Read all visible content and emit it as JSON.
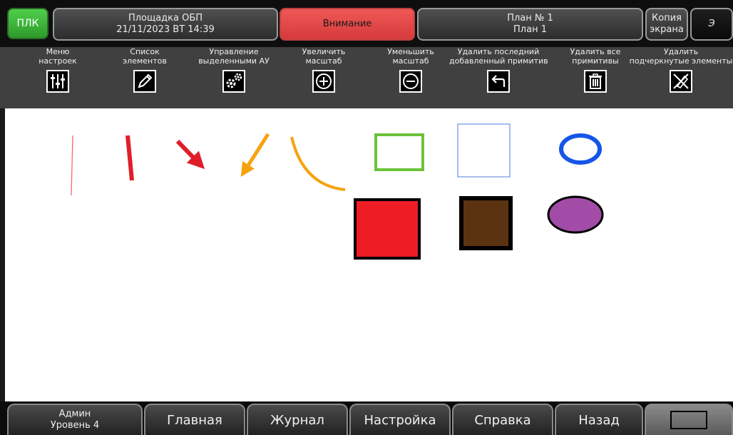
{
  "header": {
    "plc_label": "ПЛК",
    "site_name": "Площадка ОБП",
    "datetime": "21/11/2023 ВТ 14:39",
    "alert_label": "Внимание",
    "plan_number": "План № 1",
    "plan_name": "План 1",
    "screenshot_line1": "Копия",
    "screenshot_line2": "экрана",
    "extra_label": "Э"
  },
  "toolbar": {
    "settings_menu": [
      "Меню",
      "настроек"
    ],
    "element_list": [
      "Список",
      "элементов"
    ],
    "manage_selected": [
      "Управление",
      "выделенными АУ"
    ],
    "zoom_in": [
      "Увеличить",
      "масштаб"
    ],
    "zoom_out": [
      "Уменьшить",
      "масштаб"
    ],
    "undo_last": [
      "Удалить последний",
      "добавленный примитив"
    ],
    "delete_all": [
      "Удалить все",
      "примитивы"
    ],
    "delete_underlined": [
      "Удалить",
      "подчеркнутые элементы"
    ]
  },
  "footer": {
    "user_name": "Админ",
    "user_level": "Уровень 4",
    "tab_main": "Главная",
    "tab_journal": "Журнал",
    "tab_settings": "Настройка",
    "tab_help": "Справка",
    "tab_back": "Назад"
  },
  "colors": {
    "plc_green": "#3db03a",
    "alert_red": "#e24545",
    "thin_line": "#ff5a5a",
    "thick_red": "#e01e2a",
    "orange": "#f5a30f",
    "green_rect": "#6cc23a",
    "blue_rect": "#8aa8e8",
    "blue_ellipse": "#1556e8",
    "red_fill": "#ee1c25",
    "brown_fill": "#5c3310",
    "purple_fill": "#a24ca8"
  },
  "icons": [
    "sliders-icon",
    "pencil-icon",
    "gears-icon",
    "zoom-in-icon",
    "zoom-out-icon",
    "undo-arrow-icon",
    "trash-icon",
    "erase-cross-icon"
  ]
}
